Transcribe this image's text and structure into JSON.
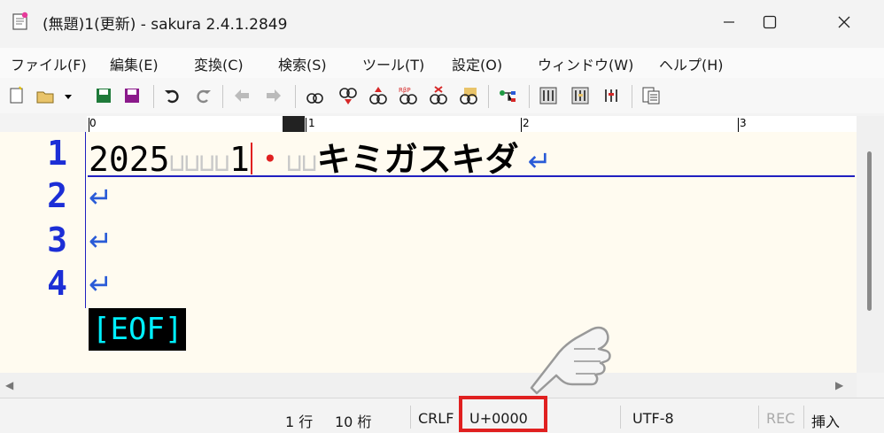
{
  "window": {
    "title": "(無題)1(更新) - sakura 2.4.1.2849",
    "minimize_icon": "minimize-icon",
    "maximize_icon": "maximize-icon",
    "close_icon": "close-icon"
  },
  "menu": [
    "ファイル(F)",
    "編集(E)",
    "変換(C)",
    "検索(S)",
    "ツール(T)",
    "設定(O)",
    "ウィンドウ(W)",
    "ヘルプ(H)"
  ],
  "ruler": {
    "labels": [
      "0",
      "1",
      "2",
      "3"
    ]
  },
  "editor": {
    "line_numbers": [
      "1",
      "2",
      "3",
      "4"
    ],
    "line1": {
      "year": "2025",
      "spaces": "⊔⊔⊔⊔",
      "after": "1",
      "mark": "・",
      "spaces2": "⊔⊔",
      "kana": "キミガスキダ"
    },
    "newline_mark": "↵",
    "eof": "[EOF]"
  },
  "status": {
    "row": "1 行",
    "col": "10 桁",
    "eol": "CRLF",
    "codepoint": "U+0000",
    "encoding": "UTF-8",
    "rec": "REC",
    "mode": "挿入"
  },
  "colors": {
    "line_number": "#1c2ed6",
    "eof_bg": "#000000",
    "eof_fg": "#00f0ff",
    "highlight": "#e02020",
    "editor_bg": "#fffbf0"
  }
}
